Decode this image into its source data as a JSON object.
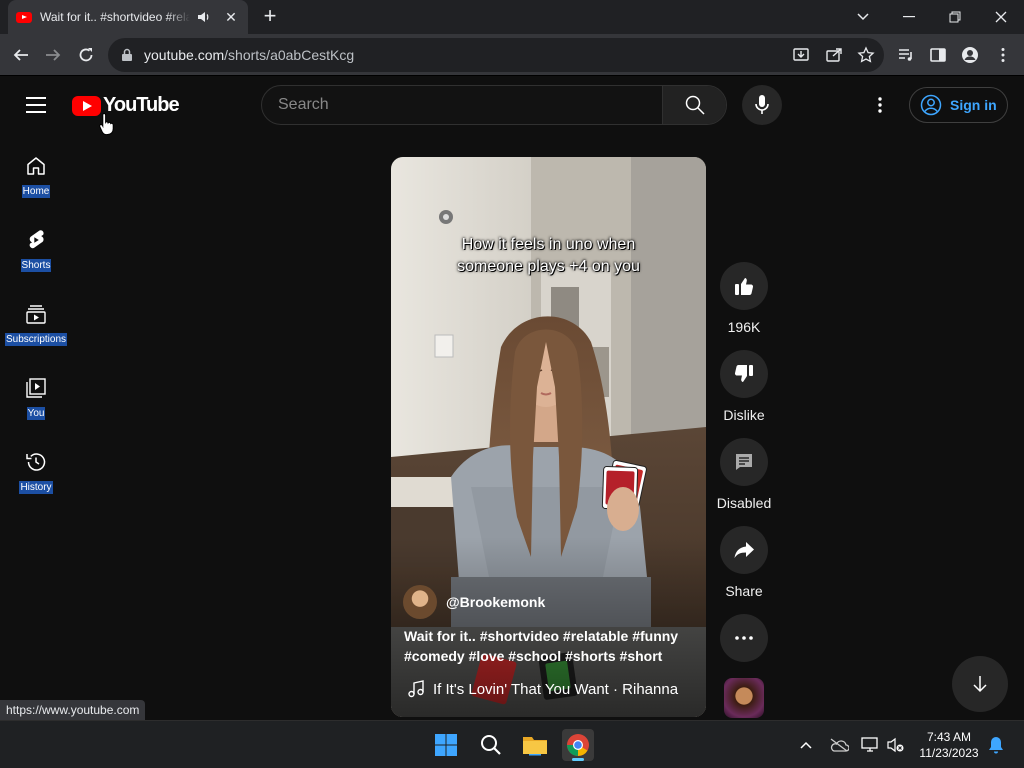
{
  "browser": {
    "tab": {
      "title": "Wait for it.. #shortvideo #relatable #funny"
    },
    "url": {
      "host": "youtube.com",
      "path": "/shorts/a0abCestKcg"
    },
    "status_url": "https://www.youtube.com"
  },
  "header": {
    "logo_text": "YouTube",
    "search_placeholder": "Search",
    "signin_label": "Sign in"
  },
  "sidebar": {
    "items": [
      {
        "label": "Home",
        "icon": "home-icon"
      },
      {
        "label": "Shorts",
        "icon": "shorts-icon"
      },
      {
        "label": "Subscriptions",
        "icon": "subscriptions-icon"
      },
      {
        "label": "You",
        "icon": "you-icon"
      },
      {
        "label": "History",
        "icon": "history-icon"
      }
    ]
  },
  "short": {
    "caption_line1": "How it feels in uno when",
    "caption_line2": "someone plays +4 on you",
    "channel": "@Brookemonk",
    "description": "Wait for it.. #shortvideo #relatable #funny #comedy #love #school #shorts #short",
    "song": "If It's Lovin' That You Want · Rihanna"
  },
  "actions": {
    "likes": "196K",
    "dislike": "Dislike",
    "comments": "Disabled",
    "share": "Share"
  },
  "taskbar": {
    "time": "7:43 AM",
    "date": "11/23/2023"
  },
  "colors": {
    "accent": "#3ea6ff",
    "youtube_red": "#ff0000",
    "background": "#0f0f0f"
  }
}
